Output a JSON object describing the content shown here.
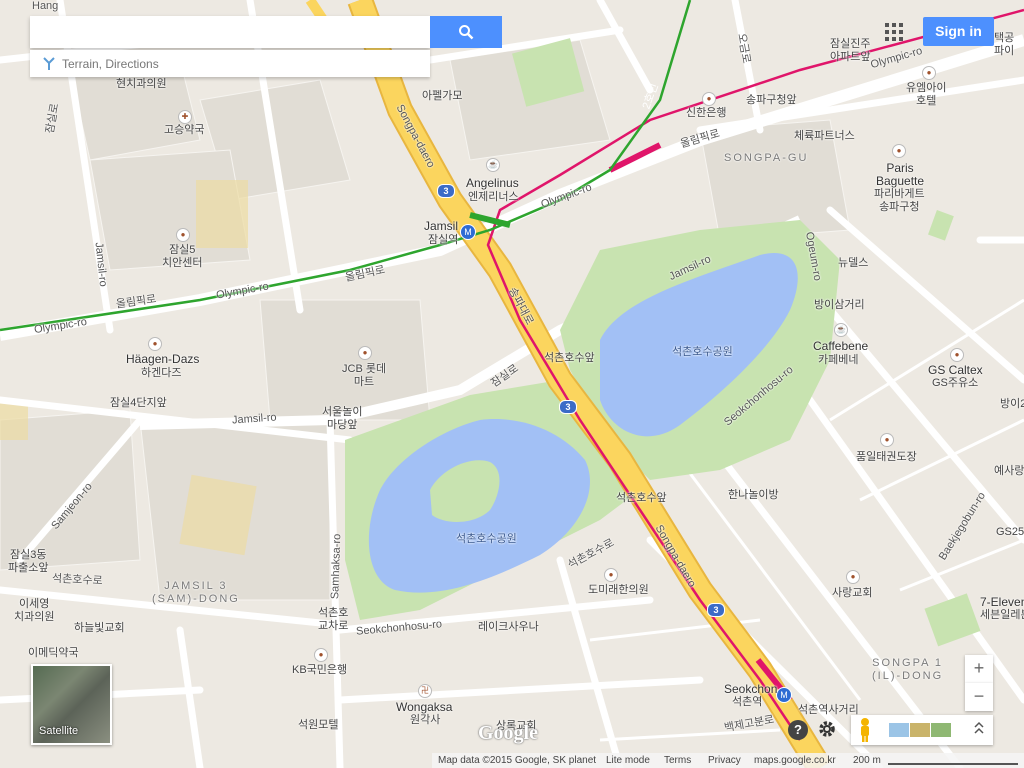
{
  "search": {
    "value": "",
    "placeholder": ""
  },
  "hint": {
    "text": "Terrain, Directions"
  },
  "header": {
    "signin_label": "Sign in"
  },
  "satellite": {
    "label": "Satellite"
  },
  "zoom": {
    "in_label": "+",
    "out_label": "−"
  },
  "footer": {
    "map_data": "Map data ©2015 Google, SK planet",
    "lite_mode": "Lite mode",
    "terms": "Terms",
    "privacy": "Privacy",
    "site": "maps.google.co.kr",
    "scale": "200 m"
  },
  "logo": "Google",
  "help_label": "?",
  "colors": {
    "water": "#a2c0f5",
    "park": "#c8e3b0",
    "highway": "#fbd55e",
    "metro_line_pink": "#e0156a",
    "metro_line_green": "#2ea52e",
    "accent_blue": "#4d90fe"
  },
  "labels": {
    "hang": "Hang",
    "mogmok": "현치과의원",
    "jamsil_ro_left": "잠실로",
    "goseung": "고승약국",
    "jamsil5": "잠실5\n치안센터",
    "jamsil_ro_v": "Jamsil-ro",
    "olympic_ko_left": "올림픽로",
    "olympic_left": "Olympic-ro",
    "olympic_ro_w": "Olympic-ro",
    "olympic_ko_mid": "올림픽로",
    "songpa_daero_n": "Songpa-daero",
    "apple": "아펠가모",
    "angelinus": "Angelinus",
    "angelinus_ko": "엔제리너스",
    "jamsil_st": "Jamsil",
    "jamsil_st_ko": "잠실역",
    "shinhan": "신한은행",
    "songpa_office": "송파구청앞",
    "olympic_ko_r": "올림픽로",
    "olympic_r": "Olympic-ro",
    "songpa_gu": "SONGPA-GU",
    "jamsil_jugong": "잠실진주\n아파트앞",
    "ohgeum": "오금로",
    "sports": "체륙파트너스",
    "paris": "Paris\nBaguette",
    "paris_ko": "파리바게트\n송파구청",
    "u_m": "유엠아이\n호텔",
    "newsdaye": "뉴델스",
    "ogeum_ro": "Ogeum-ro",
    "bangi": "방이삼거리",
    "jamsil_ro_mid": "Jamsil-ro",
    "haagen": "Häagen-Dazs",
    "haagen_ko": "하겐다즈",
    "jcb": "JCB 롯데\n마트",
    "songpa_daero_ko": "송파대로",
    "seokchon_front": "석촌호수앞",
    "seokchon_park_e": "석촌호수공원",
    "caffebene": "Caffebene",
    "caffebene_ko": "카페베네",
    "gs_caltex": "GS Caltex",
    "gs_ko": "GS주유소",
    "bangi2": "방이2",
    "jamsil4": "잠실4단지앞",
    "jamsil_ro_low": "Jamsil-ro",
    "jamsilro_ko": "잠실로",
    "seoul_play": "서울놀이\n마당앞",
    "seokchonhosu_ro": "Seokchonhosu-ro",
    "pumil": "품일태권도장",
    "yesara": "예사랑",
    "hananulie": "한나놀이방",
    "seokchon_front2": "석촌호수앞",
    "bagjegobun": "Baekjegobun-ro",
    "gs25": "GS25",
    "samjeon": "Samjeon-ro",
    "seokchon_park_w": "석촌호수공원",
    "samhaksa": "Samhaksa-ro",
    "seokchonhosu_ko": "석촌호수로",
    "songpa_daero_s": "Songpa-daero",
    "jamsil3": "잠실3동\n파출소앞",
    "seokchon_ko_l": "석촌호수로",
    "jamsil3_dong": "JAMSIL 3\n(SAM)-DONG",
    "ise": "이세영\n치과의원",
    "haneul": "하늘빛교회",
    "domirae": "도미래한의원",
    "saranggyo": "사랑교회",
    "seven": "7-Eleven",
    "seven_ko": "세븐일레븐",
    "seokchonho_gyo": "석촌호\n교차로",
    "seokchonhosu_ro2": "Seokchonhosu-ro",
    "lakesarana": "레이크사우나",
    "emedi": "이메딕약국",
    "kb": "KB국민은행",
    "wongaksa": "Wongaksa",
    "wongaksa_ko": "원각사",
    "seogwon": "석원모텔",
    "sangnokgyo": "상록교회",
    "seokchon_st": "Seokchon",
    "seokchon_st_ko": "석촌역",
    "seokchon_crossing": "석촌역사거리",
    "baekje_ko": "백제고분로",
    "songpa1": "SONGPA 1\n(IL)-DONG",
    "ssong": "송파",
    "taekgong": "택공\n파이"
  }
}
